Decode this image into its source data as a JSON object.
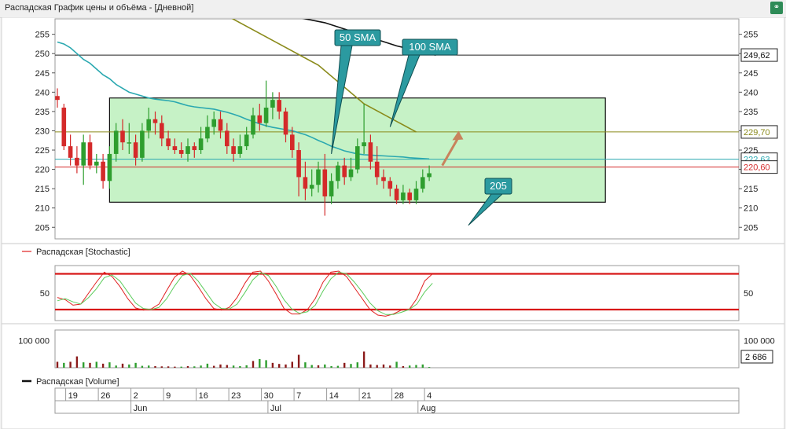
{
  "window": {
    "title": "Распадская График цены и объёма - [Дневной]"
  },
  "colors": {
    "up": "#2e9e2e",
    "down": "#d42a2a",
    "sma50": "#2aa8b0",
    "sma100": "#8a8a1a",
    "black_line": "#111111",
    "box_fill": "#c6f2c6",
    "callout": "#2b9aa0",
    "arrow": "#c8825c",
    "stoch_k": "#e02020",
    "stoch_d": "#5ccc5c",
    "stoch_band": "#d81818"
  },
  "chart_data": [
    {
      "type": "candlestick",
      "title": "",
      "y_ticks": [
        205,
        210,
        215,
        220,
        225,
        230,
        235,
        240,
        245,
        250,
        255
      ],
      "ylim": [
        202,
        259
      ],
      "x_ticks": [
        {
          "label": "19",
          "index": 2
        },
        {
          "label": "26",
          "index": 7
        },
        {
          "label": "2",
          "index": 12
        },
        {
          "label": "9",
          "index": 17
        },
        {
          "label": "16",
          "index": 22
        },
        {
          "label": "23",
          "index": 27
        },
        {
          "label": "30",
          "index": 32
        },
        {
          "label": "7",
          "index": 37
        },
        {
          "label": "14",
          "index": 42
        },
        {
          "label": "21",
          "index": 47
        },
        {
          "label": "28",
          "index": 52
        },
        {
          "label": "4",
          "index": 57
        }
      ],
      "months": [
        {
          "label": "Jun",
          "index": 12
        },
        {
          "label": "Jul",
          "index": 33
        },
        {
          "label": "Aug",
          "index": 56
        }
      ],
      "candles": [
        [
          239,
          238,
          241,
          236
        ],
        [
          236,
          226,
          237,
          225
        ],
        [
          226,
          223,
          229,
          221
        ],
        [
          223,
          221,
          226,
          219
        ],
        [
          221,
          227,
          229,
          216
        ],
        [
          227,
          221,
          229,
          220
        ],
        [
          221,
          222,
          224,
          219
        ],
        [
          222,
          217,
          224,
          215
        ],
        [
          217,
          224,
          226,
          215
        ],
        [
          224,
          230,
          232,
          222
        ],
        [
          230,
          227,
          233,
          225
        ],
        [
          227,
          227,
          232,
          224
        ],
        [
          227,
          223,
          229,
          221
        ],
        [
          223,
          230,
          232,
          222
        ],
        [
          230,
          233,
          236,
          228
        ],
        [
          233,
          232,
          235,
          229
        ],
        [
          232,
          228,
          234,
          226
        ],
        [
          228,
          226,
          230,
          225
        ],
        [
          226,
          225,
          228,
          224
        ],
        [
          225,
          224,
          227,
          223
        ],
        [
          224,
          226,
          228,
          222
        ],
        [
          226,
          225,
          227,
          223
        ],
        [
          225,
          228,
          231,
          224
        ],
        [
          228,
          231,
          234,
          227
        ],
        [
          231,
          233,
          235,
          229
        ],
        [
          233,
          230,
          235,
          228
        ],
        [
          230,
          226,
          232,
          224
        ],
        [
          226,
          224,
          228,
          222
        ],
        [
          224,
          226,
          229,
          223
        ],
        [
          226,
          229,
          231,
          225
        ],
        [
          229,
          234,
          236,
          228
        ],
        [
          234,
          232,
          237,
          230
        ],
        [
          232,
          236,
          243,
          231
        ],
        [
          236,
          238,
          240,
          233
        ],
        [
          238,
          235,
          240,
          233
        ],
        [
          235,
          229,
          236,
          227
        ],
        [
          229,
          225,
          231,
          223
        ],
        [
          225,
          218,
          227,
          213
        ],
        [
          218,
          215,
          222,
          212
        ],
        [
          215,
          216,
          220,
          213
        ],
        [
          216,
          220,
          222,
          214
        ],
        [
          220,
          213,
          224,
          208
        ],
        [
          213,
          217,
          219,
          211
        ],
        [
          217,
          221,
          222,
          215
        ],
        [
          221,
          218,
          223,
          216
        ],
        [
          218,
          220,
          223,
          217
        ],
        [
          220,
          226,
          228,
          219
        ],
        [
          226,
          227,
          237,
          224
        ],
        [
          227,
          222,
          229,
          220
        ],
        [
          222,
          218,
          226,
          216
        ],
        [
          218,
          217,
          220,
          215
        ],
        [
          217,
          215,
          218,
          213
        ],
        [
          215,
          212,
          216,
          211
        ],
        [
          212,
          214,
          216,
          211
        ],
        [
          214,
          212,
          215,
          211
        ],
        [
          212,
          215,
          217,
          211
        ],
        [
          215,
          218,
          220,
          214
        ],
        [
          218,
          219,
          221,
          217
        ]
      ],
      "sma50": [
        253,
        252.5,
        251.5,
        250,
        248.5,
        247.5,
        246,
        244.5,
        243.5,
        242,
        241,
        240,
        239.5,
        239,
        238.5,
        238.2,
        238,
        237.8,
        237.5,
        237,
        236.5,
        236.2,
        236,
        235.8,
        235.6,
        235.2,
        234.8,
        234.3,
        233.7,
        233,
        232.4,
        231.8,
        231.3,
        230.9,
        230.6,
        230.3,
        230,
        229.5,
        229,
        228.3,
        227.5,
        226.8,
        226,
        225.4,
        224.8,
        224.4,
        224,
        223.8,
        223.7,
        223.6,
        223.5,
        223.4,
        223.3,
        223.2,
        223,
        222.9,
        222.8,
        222.7
      ],
      "sma100": [
        [
          22.5,
          263
        ],
        [
          34,
          252.5
        ],
        [
          40,
          247
        ],
        [
          47,
          237
        ],
        [
          55,
          229.7
        ]
      ],
      "black_line": [
        [
          26,
          263
        ],
        [
          41,
          258
        ],
        [
          52,
          252
        ],
        [
          58,
          249.6
        ]
      ],
      "hlines": [
        {
          "y": 249.62,
          "label": "249,62"
        },
        {
          "y": 229.7,
          "label": "229,70"
        },
        {
          "y": 222.63,
          "label": "222,63"
        },
        {
          "y": 220.6,
          "label": "220,60"
        }
      ],
      "box": {
        "x0": 8,
        "x1": 84,
        "y0": 238.5,
        "y1": 211.5
      },
      "callouts": [
        {
          "text": "50 SMA",
          "tip": [
            42,
            224
          ]
        },
        {
          "text": "100 SMA",
          "tip": [
            51,
            231
          ]
        },
        {
          "text": "205",
          "tip": [
            63,
            205.5
          ]
        }
      ],
      "arrow": {
        "from": [
          59,
          221
        ],
        "to": [
          61.5,
          230
        ]
      }
    },
    {
      "type": "line",
      "legend": "Распадская [Stochastic]",
      "y_ticks": [
        50
      ],
      "ylim": [
        0,
        100
      ],
      "bands": [
        85,
        20
      ],
      "series": [
        {
          "key": "k",
          "values": [
            42,
            38,
            28,
            30,
            50,
            70,
            88,
            80,
            62,
            40,
            23,
            19,
            21,
            30,
            55,
            79,
            90,
            82,
            62,
            40,
            22,
            19,
            24,
            42,
            68,
            88,
            90,
            72,
            48,
            22,
            12,
            12,
            20,
            40,
            70,
            88,
            90,
            80,
            60,
            40,
            20,
            10,
            8,
            12,
            19,
            20,
            40,
            72,
            85
          ]
        },
        {
          "key": "d",
          "values": [
            36,
            40,
            34,
            30,
            42,
            58,
            78,
            83,
            72,
            52,
            32,
            22,
            20,
            24,
            40,
            63,
            82,
            86,
            72,
            52,
            32,
            22,
            21,
            30,
            51,
            74,
            87,
            82,
            62,
            38,
            21,
            13,
            16,
            28,
            54,
            76,
            88,
            85,
            70,
            52,
            32,
            18,
            11,
            11,
            15,
            20,
            30,
            52,
            68
          ]
        }
      ]
    },
    {
      "type": "bar",
      "legend": "Распадская [Volume]",
      "y_ticks": [
        100000
      ],
      "y_tick_labels": [
        "100 000"
      ],
      "ylim": [
        0,
        140000
      ],
      "last_value_label": "2 686",
      "values": [
        22000,
        18000,
        22000,
        42000,
        20000,
        18000,
        22000,
        15000,
        20000,
        8000,
        15000,
        12000,
        18000,
        7000,
        8000,
        6000,
        5000,
        5000,
        4000,
        4000,
        6000,
        5000,
        8000,
        15000,
        7000,
        12000,
        10000,
        8000,
        6000,
        9000,
        25000,
        32000,
        28000,
        18000,
        14000,
        12000,
        22000,
        48000,
        20000,
        10000,
        9000,
        12000,
        6000,
        7000,
        18000,
        14000,
        20000,
        60000,
        12000,
        10000,
        12000,
        8000,
        22000,
        6000,
        8000,
        10000,
        12000,
        2686
      ],
      "bar_colors_up": [
        false,
        true,
        false,
        false,
        true,
        false,
        true,
        false,
        true,
        true,
        false,
        true,
        true,
        true,
        true,
        false,
        false,
        false,
        false,
        true,
        false,
        true,
        true,
        true,
        false,
        false,
        false,
        true,
        true,
        true,
        false,
        true,
        true,
        false,
        false,
        false,
        false,
        false,
        true,
        true,
        false,
        true,
        true,
        true,
        false,
        true,
        true,
        false,
        false,
        false,
        false,
        false,
        true,
        false,
        true,
        true,
        true,
        true
      ]
    }
  ]
}
